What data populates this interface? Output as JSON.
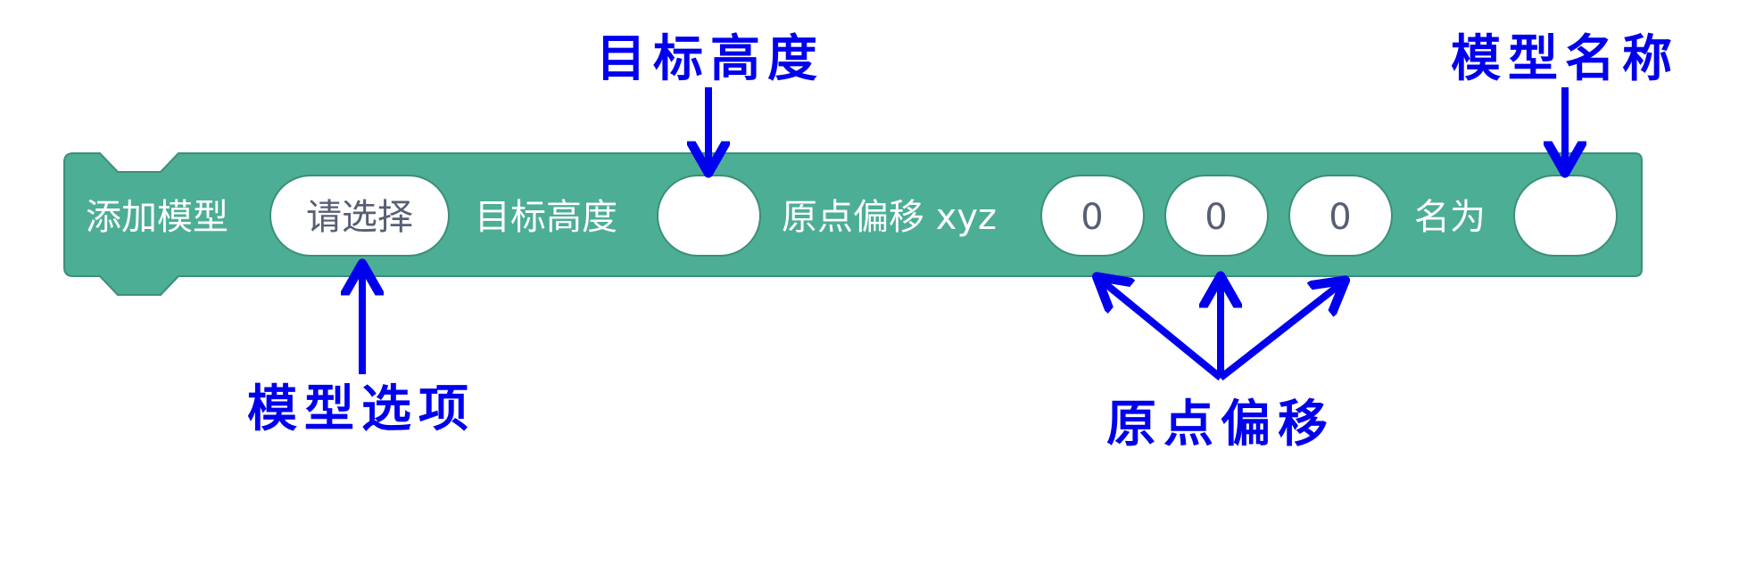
{
  "colors": {
    "block_fill": "#4cae95",
    "block_stroke": "#3b8f78",
    "block_text": "#ffffff",
    "field_fill": "#ffffff",
    "field_stroke": "#3b8f78",
    "field_text": "#575e75",
    "annotation": "#0000ee"
  },
  "block": {
    "label_add_model": "添加模型",
    "label_target_height": "目标高度",
    "label_origin_offset": "原点偏移 xyz",
    "label_named_as": "名为",
    "model_select": {
      "value": "请选择",
      "icon": "dropdown-field"
    },
    "target_height_input": {
      "value": ""
    },
    "offset_x_input": {
      "value": "0"
    },
    "offset_y_input": {
      "value": "0"
    },
    "offset_z_input": {
      "value": "0"
    },
    "model_name_input": {
      "value": ""
    }
  },
  "annotations": {
    "target_height": "目标高度",
    "model_name": "模型名称",
    "model_option": "模型选项",
    "origin_offset": "原点偏移"
  }
}
